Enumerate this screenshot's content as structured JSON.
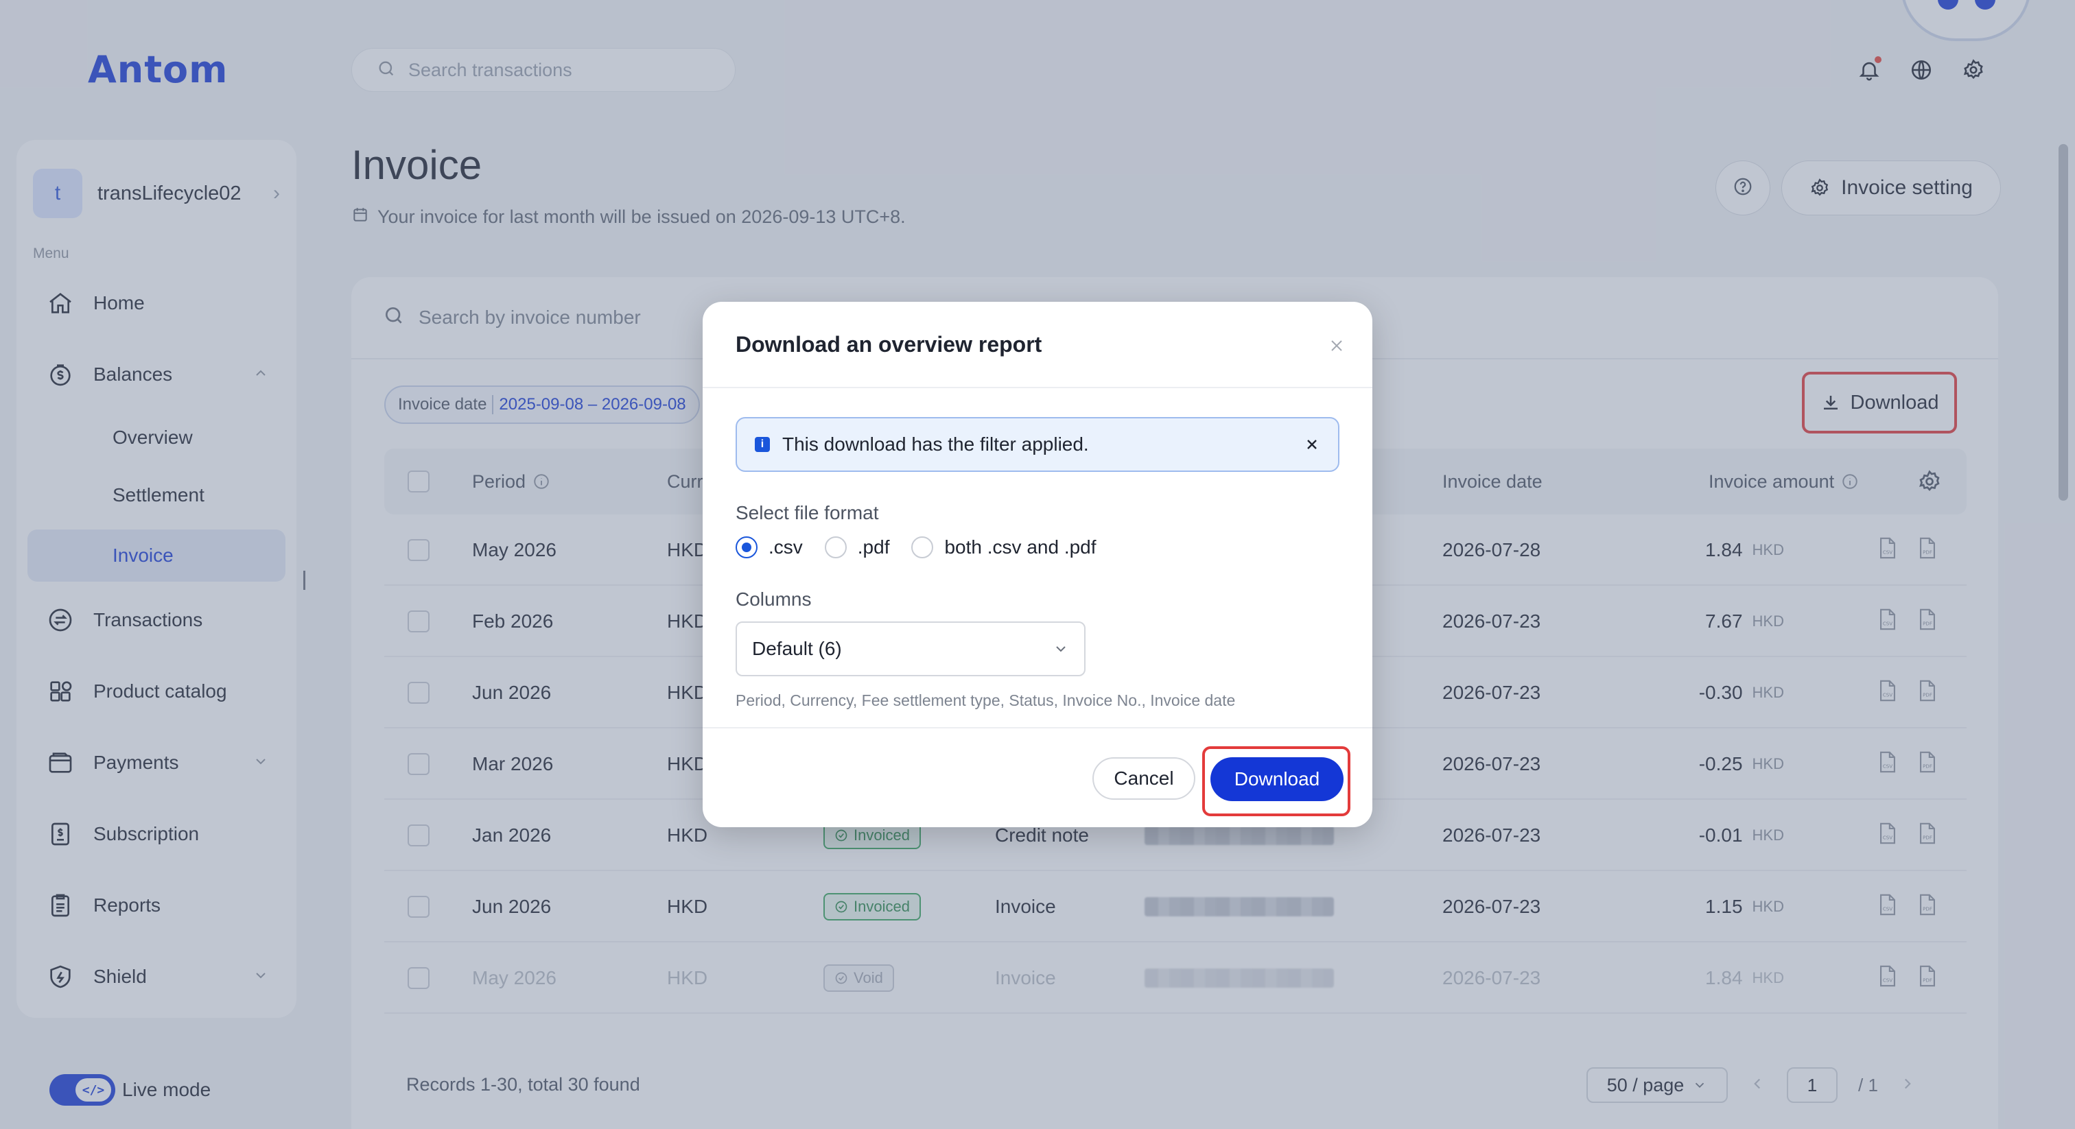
{
  "app": {
    "logo": "Antom",
    "search_placeholder": "Search transactions"
  },
  "account": {
    "initial": "t",
    "name": "transLifecycle02"
  },
  "menu": {
    "label": "Menu",
    "items": [
      {
        "label": "Home",
        "icon": "home-icon"
      },
      {
        "label": "Balances",
        "icon": "balances-icon"
      },
      {
        "label": "Overview"
      },
      {
        "label": "Settlement"
      },
      {
        "label": "Invoice"
      },
      {
        "label": "Transactions",
        "icon": "transactions-icon"
      },
      {
        "label": "Product catalog",
        "icon": "product-catalog-icon"
      },
      {
        "label": "Payments",
        "icon": "payments-icon"
      },
      {
        "label": "Subscription",
        "icon": "subscription-icon"
      },
      {
        "label": "Reports",
        "icon": "reports-icon"
      },
      {
        "label": "Shield",
        "icon": "shield-icon"
      }
    ],
    "live_mode": "Live mode"
  },
  "page": {
    "title": "Invoice",
    "subtitle": "Your invoice for last month will be issued on 2026-09-13 UTC+8.",
    "invoice_setting": "Invoice setting",
    "invoice_search_placeholder": "Search by invoice number",
    "filter_key": "Invoice date",
    "filter_value": "2025-09-08 – 2026-09-08",
    "download": "Download"
  },
  "table": {
    "headers": {
      "period": "Period",
      "currency": "Curr",
      "invoice_date": "Invoice date",
      "invoice_amount": "Invoice amount"
    },
    "rows": [
      {
        "period": "May 2026",
        "currency": "HKD",
        "status": "",
        "type": "",
        "date": "2026-07-28",
        "amount": "1.84",
        "cur": "HKD"
      },
      {
        "period": "Feb 2026",
        "currency": "HKD",
        "status": "",
        "type": "",
        "date": "2026-07-23",
        "amount": "7.67",
        "cur": "HKD"
      },
      {
        "period": "Jun 2026",
        "currency": "HKD",
        "status": "",
        "type": "",
        "date": "2026-07-23",
        "amount": "-0.30",
        "cur": "HKD"
      },
      {
        "period": "Mar 2026",
        "currency": "HKD",
        "status": "",
        "type": "",
        "date": "2026-07-23",
        "amount": "-0.25",
        "cur": "HKD"
      },
      {
        "period": "Jan 2026",
        "currency": "HKD",
        "status": "Invoiced",
        "type": "Credit note",
        "date": "2026-07-23",
        "amount": "-0.01",
        "cur": "HKD"
      },
      {
        "period": "Jun 2026",
        "currency": "HKD",
        "status": "Invoiced",
        "type": "Invoice",
        "date": "2026-07-23",
        "amount": "1.15",
        "cur": "HKD"
      },
      {
        "period": "May 2026",
        "currency": "HKD",
        "status": "Void",
        "type": "Invoice",
        "date": "2026-07-23",
        "amount": "1.84",
        "cur": "HKD"
      }
    ]
  },
  "footer": {
    "records": "Records 1-30, total 30 found",
    "per_page": "50 / page",
    "current_page": "1",
    "total_pages": "/ 1"
  },
  "modal": {
    "title": "Download an overview report",
    "alert": "This download has the filter applied.",
    "format_label": "Select file format",
    "formats": [
      ".csv",
      ".pdf",
      "both .csv and .pdf"
    ],
    "selected_format": ".csv",
    "columns_label": "Columns",
    "columns_value": "Default (6)",
    "columns_hint": "Period, Currency, Fee settlement type, Status, Invoice No., Invoice date",
    "cancel": "Cancel",
    "download": "Download"
  },
  "colors": {
    "brand": "#1a3cd6",
    "highlight": "#e33b3b",
    "invoiced_green": "#3aa55d"
  }
}
